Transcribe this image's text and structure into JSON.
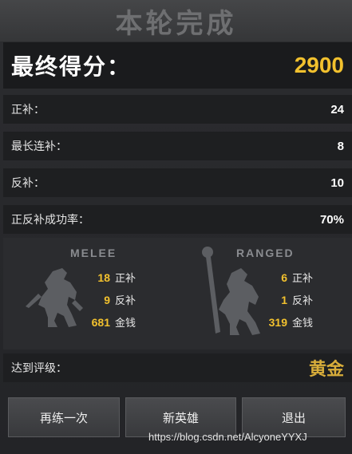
{
  "header": {
    "title": "本轮完成"
  },
  "score": {
    "label": "最终得分：",
    "value": "2900"
  },
  "stats": [
    {
      "label": "正补：",
      "value": "24"
    },
    {
      "label": "最长连补：",
      "value": "8"
    },
    {
      "label": "反补：",
      "value": "10"
    },
    {
      "label": "正反补成功率：",
      "value": "70%"
    }
  ],
  "melee": {
    "title": "MELEE",
    "last_hits": "18",
    "last_hits_label": "正补",
    "denies": "9",
    "denies_label": "反补",
    "gold": "681",
    "gold_label": "金钱"
  },
  "ranged": {
    "title": "RANGED",
    "last_hits": "6",
    "last_hits_label": "正补",
    "denies": "1",
    "denies_label": "反补",
    "gold": "319",
    "gold_label": "金钱"
  },
  "rank": {
    "label": "达到评级：",
    "value": "黄金"
  },
  "buttons": {
    "retry": "再练一次",
    "new_hero": "新英雄",
    "exit": "退出"
  },
  "watermark": "https://blog.csdn.net/AlcyoneYYXJ",
  "colors": {
    "gold_accent": "#f2c12e",
    "rank_gold": "#d8ad3a"
  }
}
